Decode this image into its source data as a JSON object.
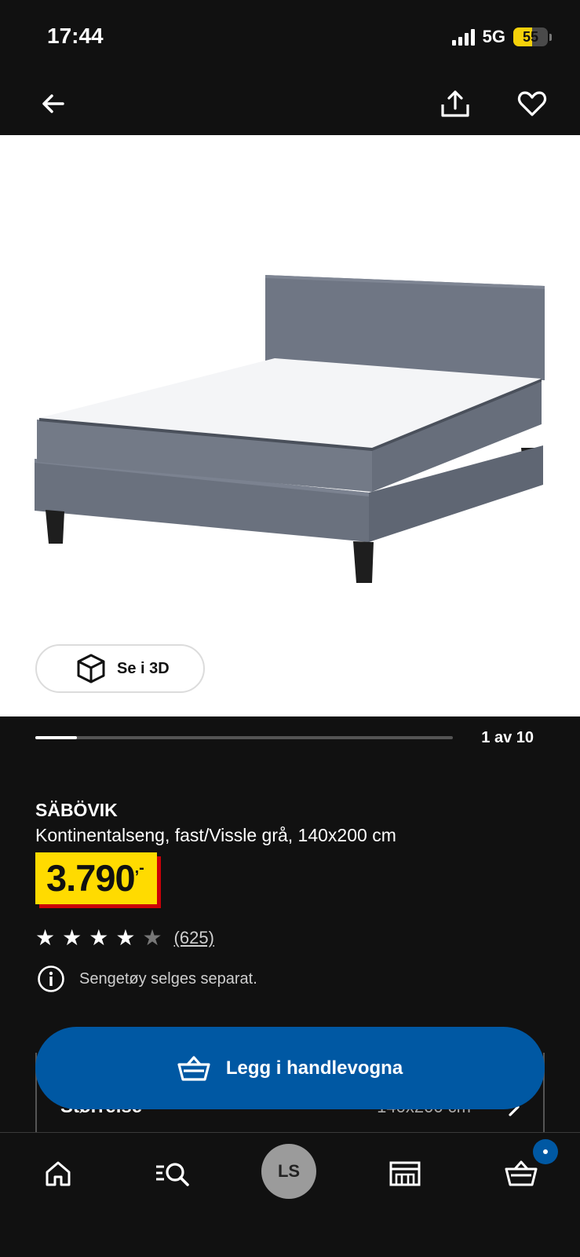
{
  "status_bar": {
    "time": "17:44",
    "network": "5G",
    "battery": "55",
    "battery_level_percent": 55
  },
  "nav": {
    "icons": [
      "back-arrow-icon",
      "share-icon",
      "heart-icon"
    ]
  },
  "gallery": {
    "view_3d_label": "Se i 3D",
    "counter": "1 av 10",
    "current": 1,
    "total": 10
  },
  "product": {
    "name": "SÄBÖVIK",
    "description": "Kontinentalseng, fast/Vissle grå, 140x200 cm",
    "price": "3.790",
    "price_suffix": ",-",
    "rating": 4,
    "rating_max": 5,
    "review_count": "(625)",
    "note": "Sengetøy selges separat."
  },
  "size_selector": {
    "label": "Størrelse",
    "value": "140x200 cm"
  },
  "cta": {
    "add_to_cart": "Legg i handlevogna"
  },
  "tab_bar": {
    "profile_initials": "LS",
    "icons": [
      "home-icon",
      "search-icon",
      "store-icon",
      "cart-icon"
    ]
  },
  "colors": {
    "background": "#111111",
    "ikea_blue": "#0058a3",
    "price_yellow": "#ffdb00",
    "price_red": "#cc0008"
  }
}
